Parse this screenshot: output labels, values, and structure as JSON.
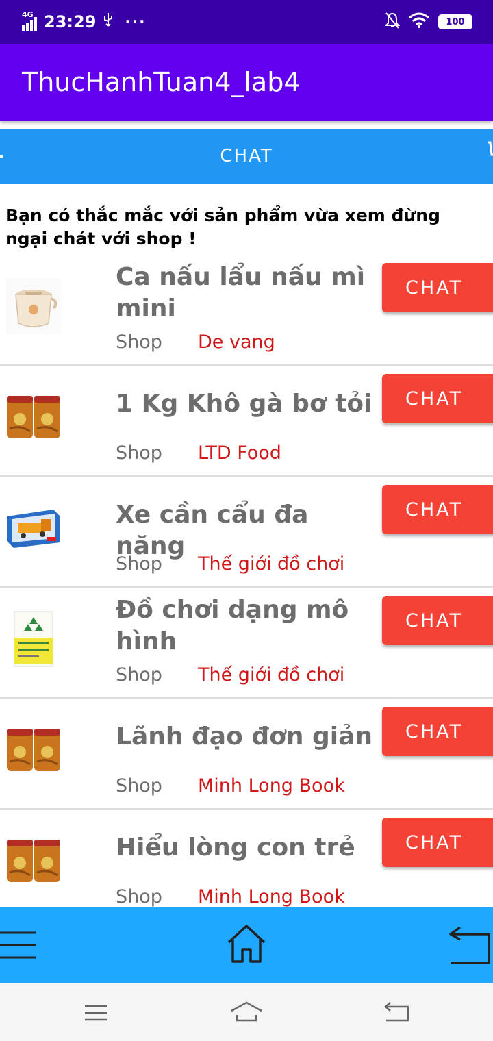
{
  "status_bar": {
    "network": "4G",
    "time": "23:29",
    "battery": "100"
  },
  "app_bar": {
    "title": "ThucHanhTuan4_lab4"
  },
  "chat_header": {
    "label": "CHAT"
  },
  "intro_text": "Bạn có thắc mắc với sản phẩm vừa xem đừng ngại chát với shop !",
  "shop_label": "Shop",
  "chat_button_label": "CHAT",
  "items": [
    {
      "title": "Ca nấu lẩu nấu mì mini",
      "shop": "De vang",
      "thumb": "pot-image"
    },
    {
      "title": "1 Kg Khô gà bơ tỏi",
      "shop": "LTD Food",
      "thumb": "jar-image"
    },
    {
      "title": "Xe cần cẩu đa năng",
      "shop": "Thế giới đồ chơi",
      "thumb": "toy-truck-image"
    },
    {
      "title": "Đồ chơi dạng mô hình",
      "shop": "Thế giới đồ chơi",
      "thumb": "book-image"
    },
    {
      "title": "Lãnh đạo đơn giản",
      "shop": "Minh Long Book",
      "thumb": "jar-image"
    },
    {
      "title": "Hiểu lòng con trẻ",
      "shop": "Minh Long Book",
      "thumb": "jar-image"
    }
  ],
  "bottom_nav": {
    "icons": [
      "menu-icon",
      "home-icon",
      "back-icon"
    ]
  },
  "system_nav": {
    "icons": [
      "menu-icon",
      "home-icon",
      "back-icon"
    ]
  },
  "colors": {
    "status_bar": "#3a00a8",
    "app_bar": "#6200ee",
    "chat_header": "#2196f3",
    "chat_button": "#f44336",
    "bottom_nav": "#1ea8ff",
    "shop_name": "#d01818"
  }
}
